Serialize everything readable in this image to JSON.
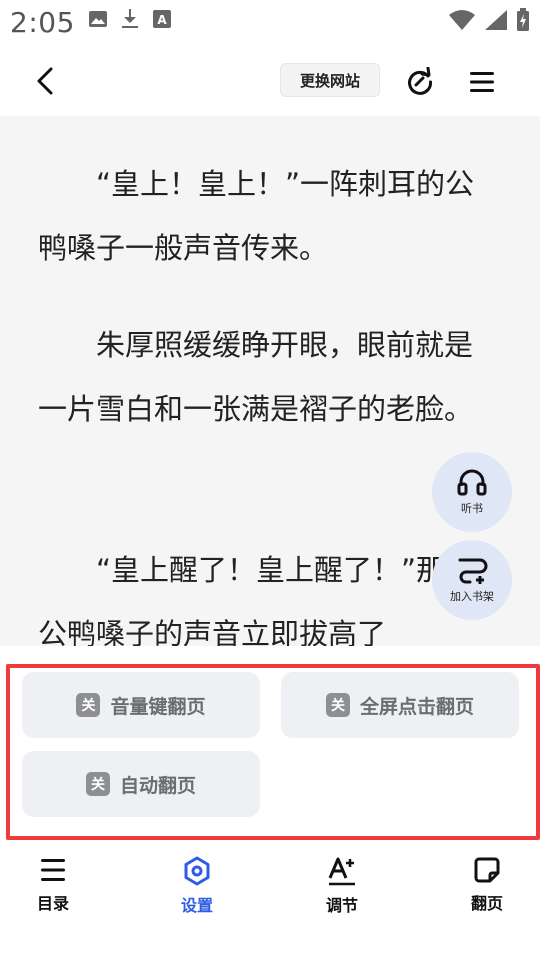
{
  "status_bar": {
    "time": "2:05",
    "left_icons": [
      "image-icon",
      "download-icon",
      "font-a-icon"
    ],
    "right_icons": [
      "wifi-icon",
      "signal-icon",
      "battery-icon"
    ]
  },
  "top_nav": {
    "change_site_label": "更换网站"
  },
  "reader": {
    "paragraphs": [
      "“皇上！皇上！”一阵刺耳的公鸭嗓子一般声音传来。",
      "朱厚照缓缓睁开眼，眼前就是一片雪白和一张满是褶子的老脸。",
      "“皇上醒了！皇上醒了！”那个公鸭嗓子的声音立即拔高了"
    ]
  },
  "fabs": {
    "listen_label": "听书",
    "add_shelf_label": "加入书架"
  },
  "settings": {
    "badge_text": "关",
    "volume_key_label": "音量键翻页",
    "fullscreen_tap_label": "全屏点击翻页",
    "auto_page_label": "自动翻页"
  },
  "bottom_nav": {
    "items": [
      {
        "label": "目录"
      },
      {
        "label": "设置"
      },
      {
        "label": "调节"
      },
      {
        "label": "翻页"
      }
    ],
    "active_color": "#2f5ce6"
  },
  "colors": {
    "highlight": "#ef3b3b",
    "reader_bg": "#f5f5f5",
    "fab_bg": "#dfe6f6",
    "toggle_bg": "#eff0f3"
  }
}
